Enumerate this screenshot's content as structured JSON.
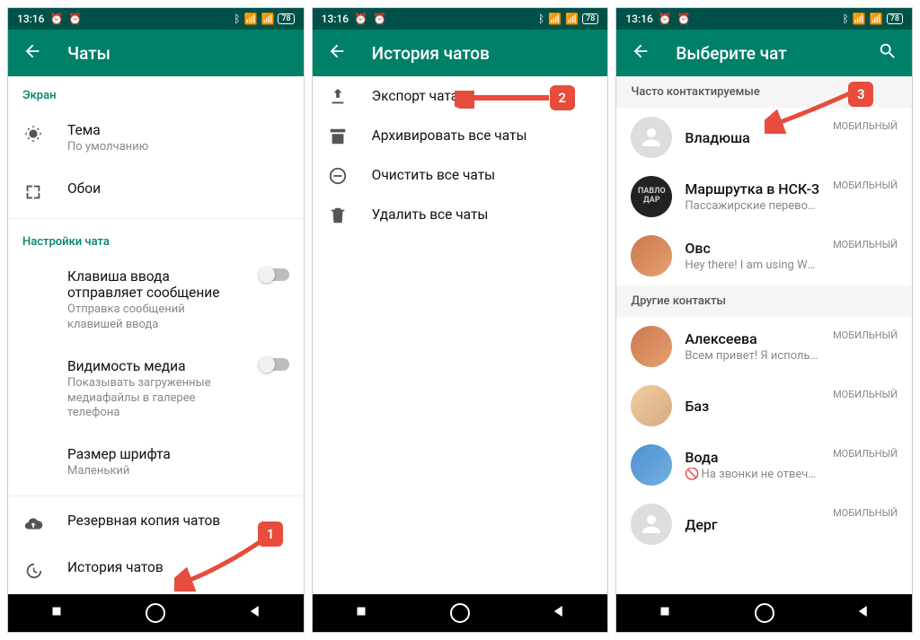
{
  "statusbar": {
    "time": "13:16",
    "battery": "78"
  },
  "screen1": {
    "title": "Чаты",
    "sect_display": "Экран",
    "theme": {
      "title": "Тема",
      "sub": "По умолчанию"
    },
    "wallpaper": "Обои",
    "sect_settings": "Настройки чата",
    "enterkey": {
      "title": "Клавиша ввода отправляет сообщение",
      "sub": "Отправка сообщений клавишей ввода"
    },
    "media": {
      "title": "Видимость медиа",
      "sub": "Показывать загруженные медиафайлы в галерее телефона"
    },
    "fontsize": {
      "title": "Размер шрифта",
      "sub": "Маленький"
    },
    "backup": "Резервная копия чатов",
    "history": "История чатов",
    "callout": "1"
  },
  "screen2": {
    "title": "История чатов",
    "export": "Экспорт чата",
    "archive": "Архивировать все чаты",
    "clear": "Очистить все чаты",
    "delete": "Удалить все чаты",
    "callout": "2"
  },
  "screen3": {
    "title": "Выберите чат",
    "sect_freq": "Часто контактируемые",
    "sect_other": "Другие контакты",
    "type": "МОБИЛЬНЫЙ",
    "c1": {
      "name": "Владюша"
    },
    "c2": {
      "name": "Маршрутка в НСК-3",
      "sub": "Пассажирские перевозки Павлодар..."
    },
    "c3": {
      "name": "Овс",
      "sub": "Hey there! I am using WhatsApp."
    },
    "c4": {
      "name": "Алексеева",
      "sub": "Всем привет! Я использую WhatsAp..."
    },
    "c5": {
      "name": "Баз"
    },
    "c6": {
      "name": "Вода",
      "sub": "На звонки не отвечаем! Не присы..."
    },
    "c7": {
      "name": "Дерг"
    },
    "callout": "3"
  }
}
